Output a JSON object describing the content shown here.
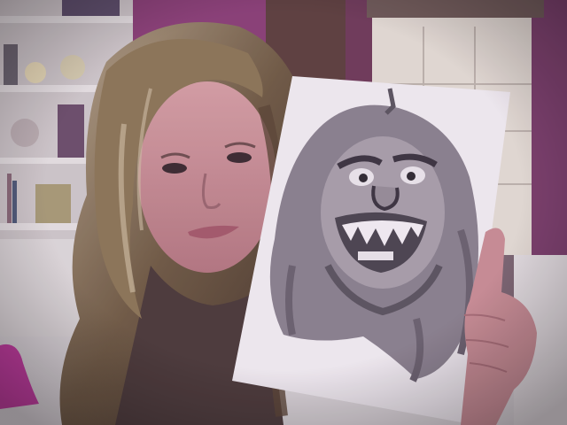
{
  "photo": {
    "kind": "webcam-selfie",
    "palette": {
      "wall_magenta": "#8a3f78",
      "shelf_white": "#d8d4d6",
      "cabinet_beige": "#e4ddd6",
      "floor": "#dcd8dc",
      "hair_brown": "#6e5a44",
      "hair_highlight": "#b8a58a",
      "skin": "#c88a92",
      "paper": "#f2eef4",
      "pencil": "#5a5460"
    }
  }
}
